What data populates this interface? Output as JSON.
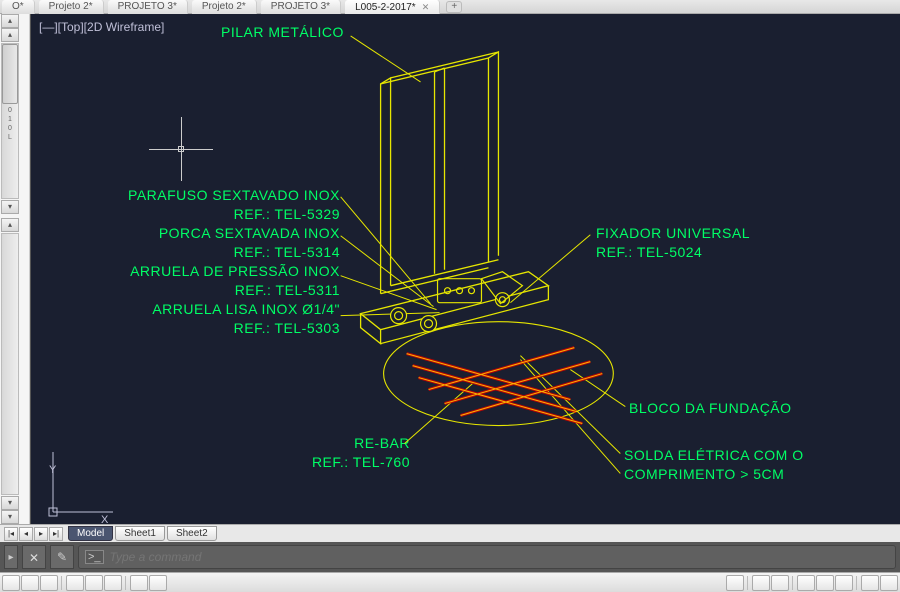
{
  "tabs": {
    "items": [
      {
        "label": "O*"
      },
      {
        "label": "Projeto 2*"
      },
      {
        "label": "PROJETO 3*"
      },
      {
        "label": "Projeto 2*"
      },
      {
        "label": "PROJETO 3*"
      },
      {
        "label": "L005-2-2017*"
      }
    ],
    "active_index": 5
  },
  "view": {
    "label": "[—][Top][2D Wireframe]",
    "ucs_y": "Y",
    "ucs_x": "X"
  },
  "annotations": {
    "pilar": "PILAR  METÁLICO",
    "parafuso_l1": "PARAFUSO SEXTAVADO INOX",
    "parafuso_l2": "REF.: TEL-5329",
    "porca_l1": "PORCA SEXTAVADA INOX",
    "porca_l2": "REF.: TEL-5314",
    "arr_pressao_l1": "ARRUELA DE PRESSÃO INOX",
    "arr_pressao_l2": "REF.: TEL-5311",
    "arr_lisa_l1": "ARRUELA LISA INOX Ø1/4\"",
    "arr_lisa_l2": "REF.: TEL-5303",
    "fixador_l1": "FIXADOR UNIVERSAL",
    "fixador_l2": "REF.: TEL-5024",
    "bloco": "BLOCO DA FUNDAÇÃO",
    "solda_l1": "SOLDA ELÉTRICA COM O",
    "solda_l2": "COMPRIMENTO > 5CM",
    "rebar_l1": "RE-BAR",
    "rebar_l2": "REF.: TEL-760"
  },
  "sheets": {
    "model": "Model",
    "sheet1": "Sheet1",
    "sheet2": "Sheet2"
  },
  "command": {
    "placeholder": "Type a command",
    "prompt": ">_"
  },
  "scale_marks": {
    "t0": "0",
    "t1": "1",
    "t2": "0",
    "t3": "L"
  }
}
